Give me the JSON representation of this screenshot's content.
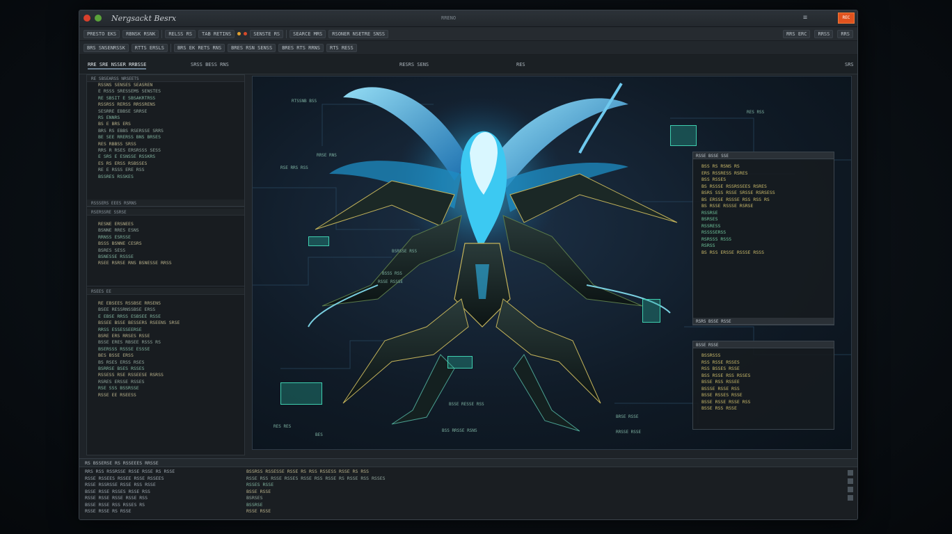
{
  "window": {
    "app_title": "Nergsackt Besrx",
    "center_title": "RRENO",
    "corner_badge": "REC"
  },
  "toolbar1": {
    "items": [
      "PRESTO EKS",
      "RBNSK RSNK",
      "RELSS RS",
      "TAB RETINS",
      "SENSTE RS",
      "SEARCE MRS",
      "RSONER NSETRE SNSS"
    ],
    "right_items": [
      "RRS ERC",
      "RRSS",
      "RRS"
    ]
  },
  "toolbar2": {
    "items": [
      "BRS SNSENRSSK",
      "RTTS ERSLS",
      "BRS EK RETS RNS",
      "BRES RSN SENSS",
      "BRES RTS RRNS",
      "RTS RESS"
    ]
  },
  "tabs": [
    {
      "label": "RRE SRE NSSER RRBSSE",
      "active": true
    },
    {
      "label": "SRSS BESS RNS"
    },
    {
      "label": "RESRS SENS"
    },
    {
      "label": "RES"
    },
    {
      "label": "SRS"
    }
  ],
  "left_panel": {
    "pane1_header": "RE SBSEARSS NRSEETS",
    "pane1_lines": [
      "RSSNS SENSES SEASREN",
      "E RSSS SRESSEMS SENSTES",
      "RE SBSIT E SBSAKRTRSS",
      "RSSRSS RERSS RRSSRENS",
      "SESRRE EBBSE SRRSE",
      "RS ENNRS",
      "BS E BRS ERS",
      "BRS RS EBBS RSERSSE SRRS",
      "BE SEE RRERSS BNS BRSES",
      "RES RBBSS SRSS",
      "RRS R RSES ERSRSSS SESS",
      "E SRS E ESNSSE RSSKRS",
      "ES RS ERSS RSBSSES",
      "RE E RSSS ERE RSS",
      "BSSRES RSSKES"
    ],
    "pane1_footer": "RSSSERS EEES RSRNS",
    "pane2_header": "RSERSSRE SSRSE",
    "pane2_lines": [
      "RESNE ERSNEES",
      "BSNNE RRES ESNS",
      "RRNSS ESRSSE",
      "BSSS BSNNE CESRS",
      "BSRES SESS",
      "BSNESSE RSSSE",
      "RSEE RSRSE RNS BSNESSE RRSS"
    ],
    "pane3_header": "RSEES EE",
    "pane3_lines": [
      "RE EBSEES RSSBSE RRSENS",
      "BSEE RESSRNSSBSE ERSS",
      "E EBSE RRSS ESBSEE RSSE",
      "BSSEE BSSE BESSERS RSEENS SRSE",
      "",
      "RRSS ESSESSEERSE",
      "BSRE ERS RRSES RSSE",
      "BSSE ERES RBSEE RSSS RS",
      "BSERSSS RSSSE ESSSE",
      "BES BSSE ERSS",
      "BS RSES ERSS RSES",
      "BSRRSE BSES RSSES",
      "RSSESS RSE RSSEESE RSRSS",
      "RSRES ERSSE RSSES",
      "RSE SSS BSSRSSE",
      "RSSE EE RSEESS"
    ]
  },
  "viewport": {
    "labels": [
      "RTSSNB BSS",
      "RSE RRS RSS",
      "RRSE RNS",
      "BSRSSE RSS",
      "RSSE RSSSE",
      "BSSS RSS",
      "BSSE RESSE RSS",
      "BSS RRSSE RSNS",
      "RES RSS",
      "BRSE RSSE",
      "RRSSE RSSE",
      "RES RES",
      "BES"
    ]
  },
  "float_panel1": {
    "title": "RSSE BSSE SSE",
    "lines": [
      {
        "t": "BSS RS RSNS RS",
        "c": "y"
      },
      {
        "t": "ERS RSSRESS RSRES",
        "c": "y"
      },
      {
        "t": "BSS RSSES",
        "c": "y"
      },
      {
        "t": "BS RSSSE RSSRSSEES RSRES",
        "c": "y"
      },
      {
        "t": "BSRS SSS RSSE SRSSE RSRSESS",
        "c": "y"
      },
      {
        "t": "BS ERSSE RSSSE RSS RSS RS",
        "c": "y"
      },
      {
        "t": "BS RSSE RSSSE RSRSE",
        "c": "y"
      },
      {
        "t": "",
        "c": "y"
      },
      {
        "t": "RSSRSE",
        "c": "g"
      },
      {
        "t": "BSRSES",
        "c": "g"
      },
      {
        "t": "RSSRESS",
        "c": "g"
      },
      {
        "t": "RSSSSERSS",
        "c": "g"
      },
      {
        "t": "RSRSSS RSSS",
        "c": "g"
      },
      {
        "t": "RSRSS",
        "c": "g"
      },
      {
        "t": "BS RSS ERSSE RSSSE RSSS",
        "c": "y"
      }
    ],
    "footer": "RSRS BSSE RSSE"
  },
  "float_panel2": {
    "title": "BSSE RSSE",
    "lines": [
      {
        "t": "BSSRSSS",
        "c": "y"
      },
      {
        "t": "RSS RSSE RSSES",
        "c": "y"
      },
      {
        "t": "RSS BSSES RSSE",
        "c": "y"
      },
      {
        "t": "BSS RSSE RSS RSSES",
        "c": "y"
      },
      {
        "t": "BSSE RSS RSSEE",
        "c": "y"
      },
      {
        "t": "BSSSE RSSE RSS",
        "c": "y"
      },
      {
        "t": "BSSE RSSES RSSE",
        "c": "y"
      },
      {
        "t": "BSSE RSSE RSSE RSS",
        "c": "y"
      },
      {
        "t": "BSSE RSS RSSE",
        "c": "y"
      }
    ]
  },
  "bottom_panel": {
    "header": "RS BSSERSE RS RSSEEES RRSSE",
    "left_lines": [
      "RRS RSS RSSRSSE RSSE RSSE RS RSSE",
      "RSSE RSSEES RSSEE RSSE RSSEES",
      "RSSE RSSRSSE RSSE RSS RSSE",
      "BSSE RSSE RSSES RSSE RSS",
      "RSSE RSSE RSSE RSSE RSS",
      "BSSE RSSE RSS RSSES RS",
      "RSSE RSSE RS RSSE"
    ],
    "right_lines": [
      "BSSRSS RSSESSE RSSE RS RSS RSSESS RSSE RS RSS",
      "RSSE RSS RSSE RSSES RSSE RSS RSSE RS RSSE RSS RSSES",
      "RSSES RSSE",
      "BSSE RSSE",
      "BSRSES",
      "BSSRSE",
      "RSSE RSSE"
    ]
  }
}
